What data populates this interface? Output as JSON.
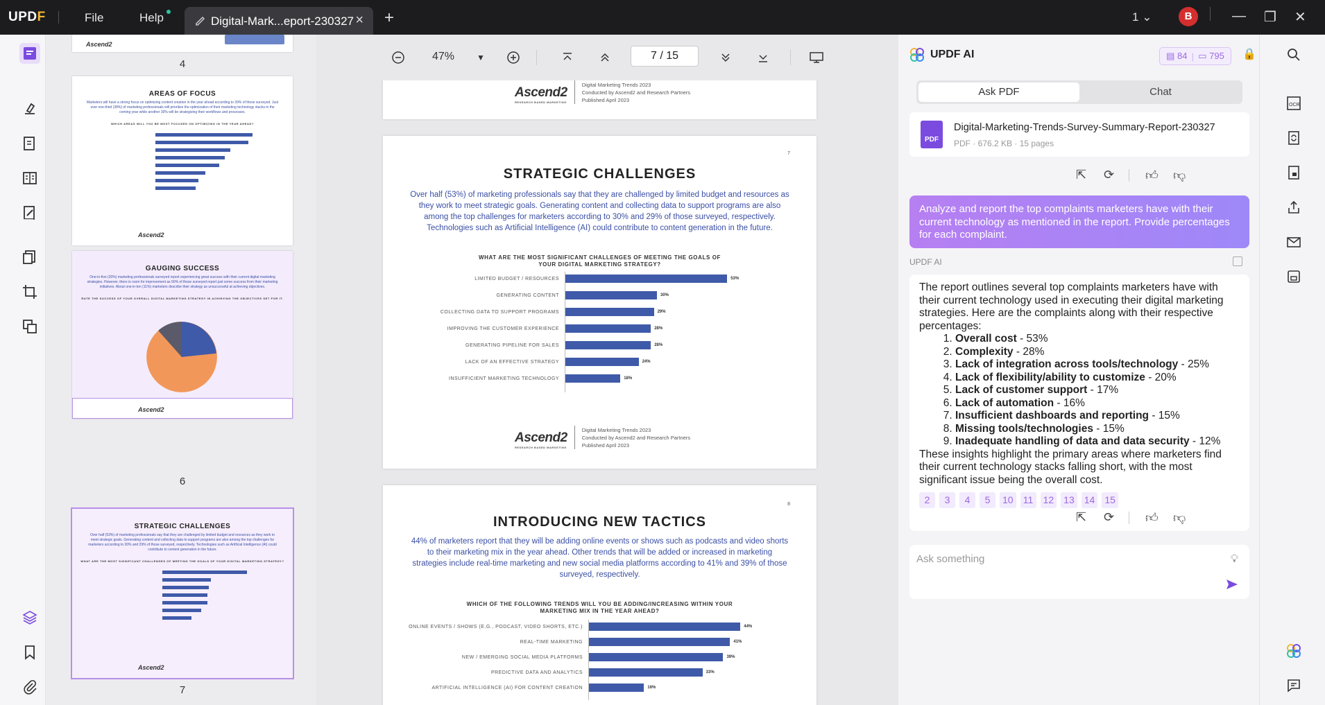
{
  "app": {
    "logo": "UPDF",
    "menu_file": "File",
    "menu_help": "Help",
    "tab_title": "Digital-Mark...eport-230327",
    "page_select": "1",
    "avatar_letter": "B",
    "accent": "#9b6ae0"
  },
  "viewer": {
    "zoom": "47%",
    "current_page": "7",
    "total_pages": "15"
  },
  "thumbnails": [
    {
      "num": "4",
      "title": "",
      "foot": "Ascend2"
    },
    {
      "num": "5",
      "title": "AREAS OF FOCUS",
      "text": "Marketers will have a strong focus on optimizing content creation in the year ahead according to 39% of those surveyed. Just over one-third (38%) of marketing professionals will prioritize the optimization of their marketing technology stacks in the coming year while another 30% will be strategizing their workflows and processes.",
      "q": "WHICH AREAS WILL YOU BE MOST FOCUSED ON OPTIMIZING IN THE YEAR AHEAD?",
      "foot": "Ascend2"
    },
    {
      "num": "6",
      "title": "GAUGING SUCCESS",
      "text": "One-in-five (20%) marketing professionals surveyed report experiencing great success with their current digital marketing strategies. However, there is room for improvement as 60% of those surveyed report just some success from their marketing initiatives. About one-in-ten (11%) marketers describe their strategy as unsuccessful at achieving objectives.",
      "q": "RATE THE SUCCESS OF YOUR OVERALL DIGITAL MARKETING STRATEGY IN ACHIEVING THE OBJECTIVES SET FOR IT.",
      "foot": "Ascend2"
    },
    {
      "num": "7",
      "title": "STRATEGIC CHALLENGES",
      "text": "Over half (53%) of marketing professionals say that they are challenged by limited budget and resources as they work to meet strategic goals. Generating content and collecting data to support programs are also among the top challenges for marketers according to 30% and 29% of those surveyed, respectively. Technologies such as Artificial Intelligence (AI) could contribute to content generation in the future.",
      "q": "WHAT ARE THE MOST SIGNIFICANT CHALLENGES OF MEETING THE GOALS OF YOUR DIGITAL MARKETING STRATEGY?",
      "foot": "Ascend2"
    }
  ],
  "pages": {
    "prev_footer": {
      "brand": "Ascend2",
      "tag": "RESEARCH BASED MARKETING",
      "line1": "Digital Marketing Trends 2023",
      "line2": "Conducted by Ascend2 and Research Partners",
      "line3": "Published April 2023"
    },
    "p7": {
      "num": "7",
      "title": "STRATEGIC CHALLENGES",
      "body": "Over half (53%) of marketing professionals say that they are challenged by limited budget and resources as they work to meet strategic goals. Generating content and collecting data to support programs are also among the top challenges for marketers according to 30% and 29% of those surveyed, respectively. Technologies such as Artificial Intelligence (AI) could contribute to content generation in the future.",
      "q1": "WHAT ARE THE MOST SIGNIFICANT CHALLENGES OF MEETING THE GOALS OF",
      "q2": "YOUR DIGITAL MARKETING STRATEGY?"
    },
    "p8": {
      "num": "8",
      "title": "INTRODUCING NEW TACTICS",
      "body": "44% of marketers report that they will be adding online events or shows such as podcasts and video shorts to their marketing mix in the year ahead. Other trends that will be added or increased in marketing strategies include real-time marketing and new social media platforms according to 41% and 39% of those surveyed, respectively.",
      "q1": "WHICH OF THE FOLLOWING TRENDS WILL YOU BE ADDING/INCREASING WITHIN YOUR",
      "q2": "MARKETING MIX IN THE YEAR AHEAD?"
    }
  },
  "chart_data": [
    {
      "type": "bar",
      "title": "WHAT ARE THE MOST SIGNIFICANT CHALLENGES OF MEETING THE GOALS OF YOUR DIGITAL MARKETING STRATEGY?",
      "categories": [
        "LIMITED BUDGET / RESOURCES",
        "GENERATING CONTENT",
        "COLLECTING DATA TO SUPPORT PROGRAMS",
        "IMPROVING THE CUSTOMER EXPERIENCE",
        "GENERATING PIPELINE FOR SALES",
        "LACK OF AN EFFECTIVE STRATEGY",
        "INSUFFICIENT MARKETING TECHNOLOGY"
      ],
      "values": [
        53,
        30,
        29,
        28,
        28,
        24,
        18
      ],
      "value_labels": [
        "53%",
        "30%",
        "29%",
        "28%",
        "28%",
        "24%",
        "18%"
      ],
      "xlim": [
        0,
        60
      ],
      "color": "#3f5aa8"
    },
    {
      "type": "bar",
      "title": "WHICH OF THE FOLLOWING TRENDS WILL YOU BE ADDING/INCREASING WITHIN YOUR MARKETING MIX IN THE YEAR AHEAD?",
      "categories": [
        "ONLINE EVENTS / SHOWS (E.G., PODCAST, VIDEO SHORTS, ETC.)",
        "REAL-TIME MARKETING",
        "NEW / EMERGING SOCIAL MEDIA PLATFORMS",
        "PREDICTIVE DATA AND ANALYTICS",
        "ARTIFICIAL INTELLIGENCE (AI) FOR CONTENT CREATION"
      ],
      "values": [
        44,
        41,
        39,
        33,
        16
      ],
      "value_labels": [
        "44%",
        "41%",
        "39%",
        "33%",
        "16%"
      ],
      "xlim": [
        0,
        50
      ],
      "color": "#3f5aa8"
    }
  ],
  "ai": {
    "title": "UPDF AI",
    "credits_a": "84",
    "credits_b": "795",
    "tab_ask": "Ask PDF",
    "tab_chat": "Chat",
    "file_name": "Digital-Marketing-Trends-Survey-Summary-Report-230327",
    "file_meta": "PDF · 676.2 KB · 15 pages",
    "pdf_badge": "PDF",
    "user_prompt": "Analyze and report the top complaints marketers have with their current technology as mentioned in the report. Provide percentages for each complaint.",
    "ai_label": "UPDF AI",
    "answer_intro": "The report outlines several top complaints marketers have with their current technology used in executing their digital marketing strategies. Here are the complaints along with their respective percentages:",
    "complaints": [
      {
        "name": "Overall cost",
        "pct": " - 53%"
      },
      {
        "name": "Complexity",
        "pct": " - 28%"
      },
      {
        "name": "Lack of integration across tools/technology",
        "pct": " - 25%"
      },
      {
        "name": "Lack of flexibility/ability to customize",
        "pct": " - 20%"
      },
      {
        "name": "Lack of customer support",
        "pct": " - 17%"
      },
      {
        "name": "Lack of automation",
        "pct": " - 16%"
      },
      {
        "name": "Insufficient dashboards and reporting",
        "pct": " - 15%"
      },
      {
        "name": "Missing tools/technologies",
        "pct": " - 15%"
      },
      {
        "name": "Inadequate handling of data and data security",
        "pct": " - 12%"
      }
    ],
    "answer_outro": "These insights highlight the primary areas where marketers find their current technology stacks falling short, with the most significant issue being the overall cost.",
    "refs": [
      "2",
      "3",
      "4",
      "5",
      "10",
      "11",
      "12",
      "13",
      "14",
      "15"
    ],
    "ask_placeholder": "Ask something"
  }
}
